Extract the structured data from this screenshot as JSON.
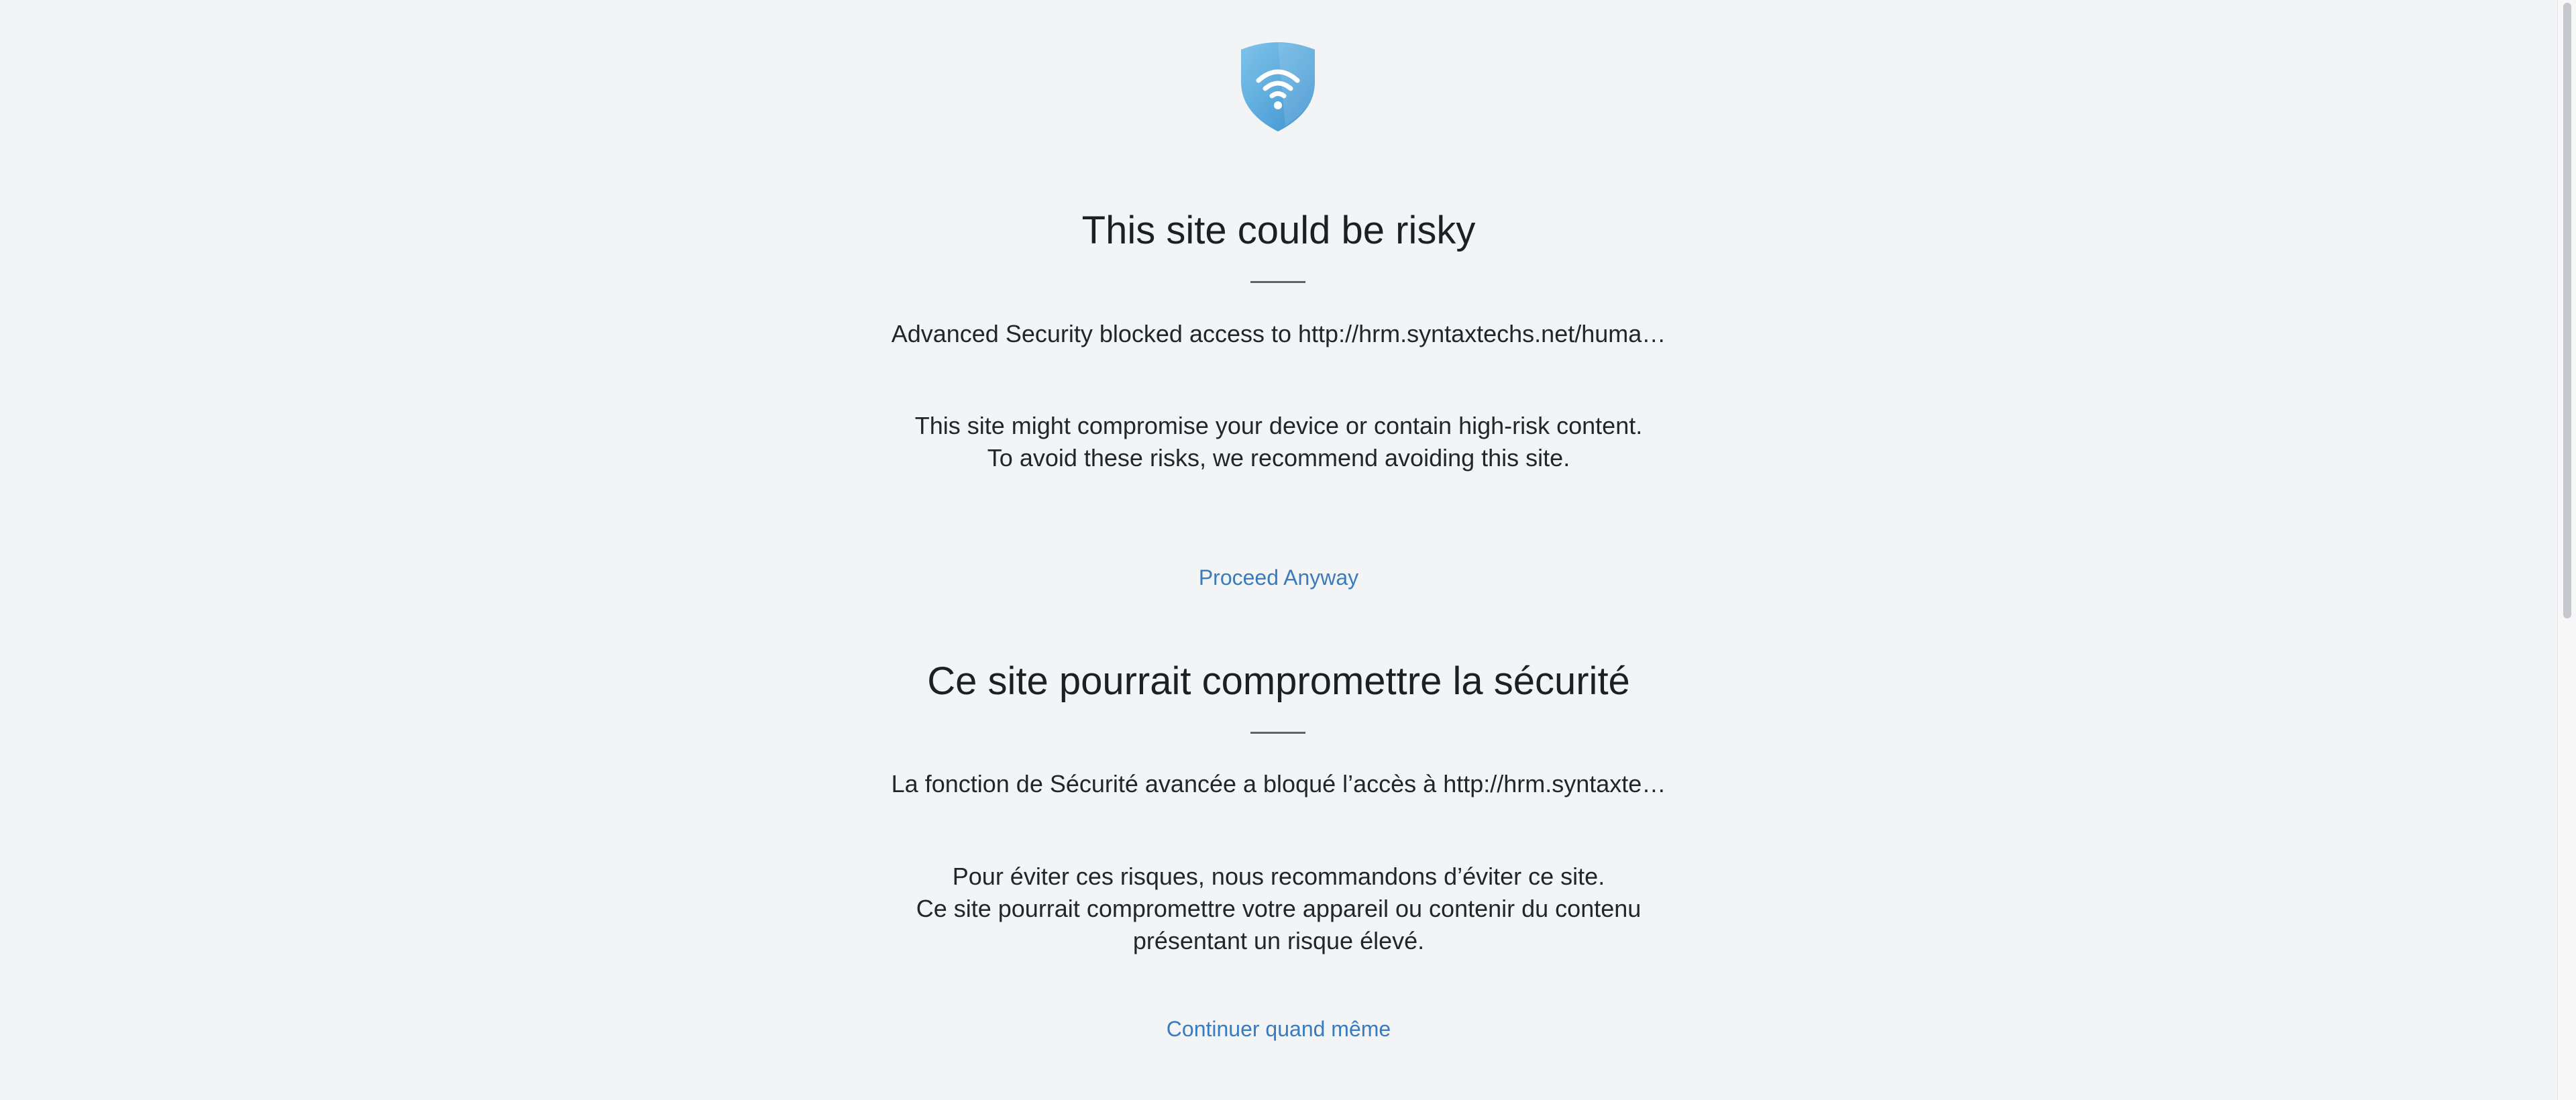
{
  "logo": {
    "icon": "wifi-shield-icon",
    "color": "#5aa9dc"
  },
  "english": {
    "title": "This site could be risky",
    "blocked_text": "Advanced Security blocked access to http://hrm.syntaxtechs.net/huma…",
    "description_lines": [
      "This site might compromise your device or contain high-risk content.",
      "To avoid these risks, we recommend avoiding this site."
    ],
    "proceed_link": "Proceed Anyway"
  },
  "french": {
    "title": "Ce site pourrait compromettre la sécurité",
    "blocked_text": "La fonction de Sécurité avancée a bloqué l’accès à http://hrm.syntaxte…",
    "description_lines": [
      "Pour éviter ces risques, nous recommandons d’éviter ce site.",
      "Ce site pourrait compromettre votre appareil ou contenir du contenu",
      "présentant un risque élevé."
    ],
    "proceed_link": "Continuer quand même"
  },
  "colors": {
    "background": "#f2f4f6",
    "link": "#3a7bbf",
    "text": "#1c1f24"
  }
}
